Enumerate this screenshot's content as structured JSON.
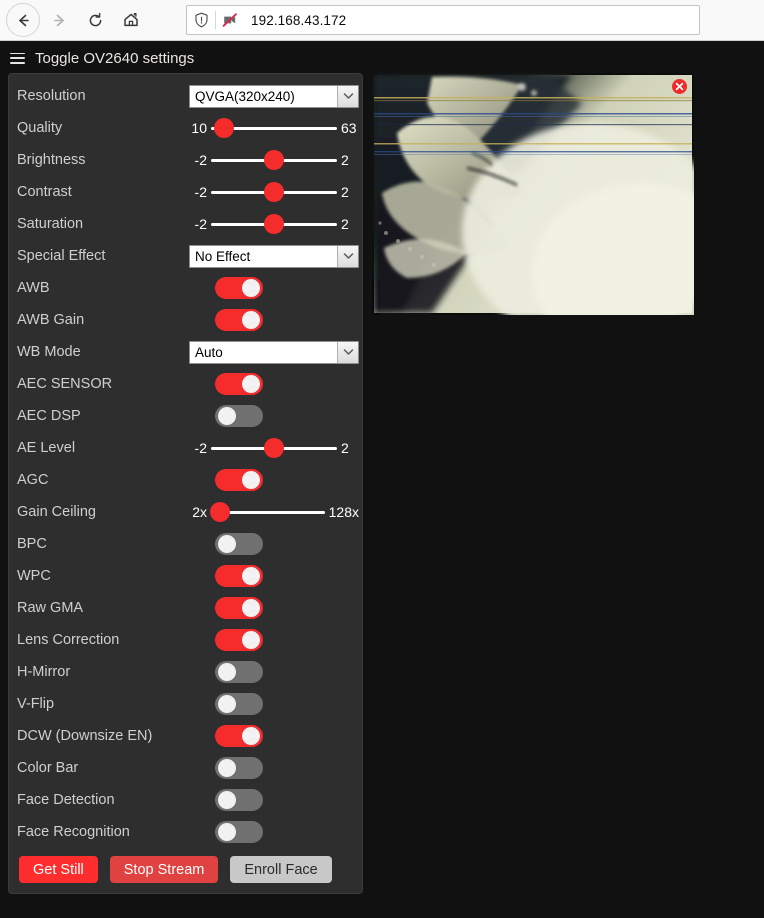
{
  "browser": {
    "back_icon": "arrow-left-icon",
    "forward_icon": "arrow-right-icon",
    "reload_icon": "reload-icon",
    "home_icon": "home-icon",
    "shield_icon": "shield-icon",
    "permission_blocked_icon": "camera-blocked-icon",
    "url": "192.168.43.172"
  },
  "page": {
    "header": {
      "menu_icon": "hamburger-icon",
      "title": "Toggle OV2640 settings"
    },
    "settings": [
      {
        "label": "Resolution",
        "type": "select",
        "value": "QVGA(320x240)"
      },
      {
        "label": "Quality",
        "type": "slider",
        "min": "10",
        "max": "63",
        "pos": 10
      },
      {
        "label": "Brightness",
        "type": "slider",
        "min": "-2",
        "max": "2",
        "pos": 50
      },
      {
        "label": "Contrast",
        "type": "slider",
        "min": "-2",
        "max": "2",
        "pos": 50
      },
      {
        "label": "Saturation",
        "type": "slider",
        "min": "-2",
        "max": "2",
        "pos": 50
      },
      {
        "label": "Special Effect",
        "type": "select",
        "value": "No Effect"
      },
      {
        "label": "AWB",
        "type": "switch",
        "on": true
      },
      {
        "label": "AWB Gain",
        "type": "switch",
        "on": true
      },
      {
        "label": "WB Mode",
        "type": "select",
        "value": "Auto"
      },
      {
        "label": "AEC SENSOR",
        "type": "switch",
        "on": true
      },
      {
        "label": "AEC DSP",
        "type": "switch",
        "on": false
      },
      {
        "label": "AE Level",
        "type": "slider",
        "min": "-2",
        "max": "2",
        "pos": 50
      },
      {
        "label": "AGC",
        "type": "switch",
        "on": true
      },
      {
        "label": "Gain Ceiling",
        "type": "slider",
        "min": "2x",
        "max": "128x",
        "pos": 8
      },
      {
        "label": "BPC",
        "type": "switch",
        "on": false
      },
      {
        "label": "WPC",
        "type": "switch",
        "on": true
      },
      {
        "label": "Raw GMA",
        "type": "switch",
        "on": true
      },
      {
        "label": "Lens Correction",
        "type": "switch",
        "on": true
      },
      {
        "label": "H-Mirror",
        "type": "switch",
        "on": false
      },
      {
        "label": "V-Flip",
        "type": "switch",
        "on": false
      },
      {
        "label": "DCW (Downsize EN)",
        "type": "switch",
        "on": true
      },
      {
        "label": "Color Bar",
        "type": "switch",
        "on": false
      },
      {
        "label": "Face Detection",
        "type": "switch",
        "on": false
      },
      {
        "label": "Face Recognition",
        "type": "switch",
        "on": false
      }
    ],
    "buttons": [
      {
        "label": "Get Still",
        "style": "primary"
      },
      {
        "label": "Stop Stream",
        "style": "secondary"
      },
      {
        "label": "Enroll Face",
        "style": "neutral"
      }
    ],
    "stream": {
      "close_icon": "close-icon",
      "description": "camera-stream"
    }
  },
  "colors": {
    "accent_red": "#f42c2c",
    "panel_bg": "#2e2e2e",
    "page_bg": "#111111",
    "toggle_off": "#707070"
  }
}
